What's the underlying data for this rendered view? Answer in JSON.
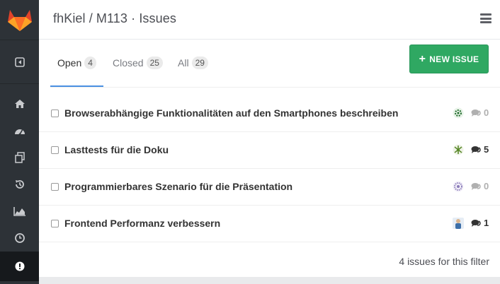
{
  "header": {
    "title": "fhKiel / M113 · Issues"
  },
  "sidebar": {
    "items": [
      {
        "icon": "collapse-sidebar-icon"
      },
      {
        "icon": "home-icon"
      },
      {
        "icon": "dashboard-icon"
      },
      {
        "icon": "files-icon"
      },
      {
        "icon": "history-icon"
      },
      {
        "icon": "graph-icon"
      },
      {
        "icon": "clock-icon"
      },
      {
        "icon": "issues-icon",
        "active": true
      }
    ]
  },
  "tabs": [
    {
      "label": "Open",
      "count": "4",
      "active": true
    },
    {
      "label": "Closed",
      "count": "25"
    },
    {
      "label": "All",
      "count": "29"
    }
  ],
  "new_issue_button": {
    "label": "NEW ISSUE"
  },
  "issues": [
    {
      "title": "Browserabhängige Funktionalitäten auf den Smartphones beschreiben",
      "comments": "0",
      "avatar_color": "#2e7d32"
    },
    {
      "title": "Lasttests für die Doku",
      "comments": "5",
      "avatar_color": "#6a8f3a"
    },
    {
      "title": "Programmierbares Szenario für die Präsentation",
      "comments": "0",
      "avatar_color": "#8a7bb8"
    },
    {
      "title": "Frontend Performanz verbessern",
      "comments": "1",
      "avatar_color": "#3d6fa8"
    }
  ],
  "footer": {
    "summary": "4 issues for this filter"
  },
  "colors": {
    "sidebar_bg": "#2d3237",
    "accent_blue": "#4a90e2",
    "success_green": "#2fa862",
    "logo_orange": "#e24329"
  }
}
